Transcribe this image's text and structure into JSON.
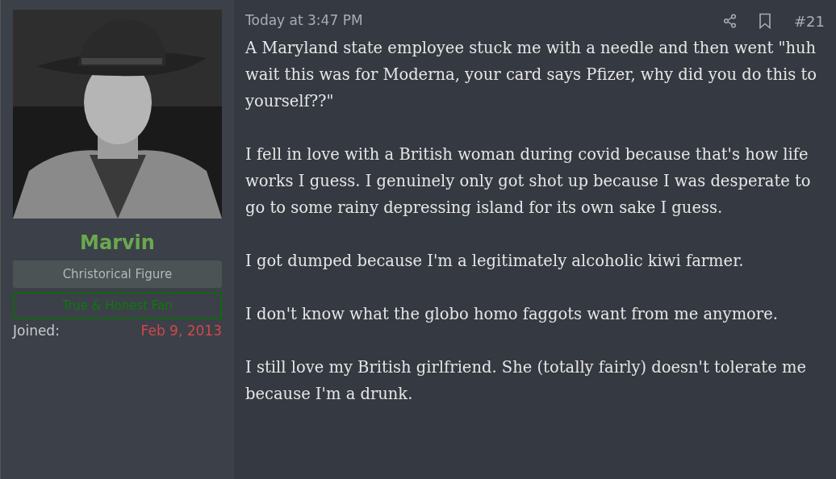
{
  "author": {
    "name": "Marvin",
    "title": "Christorical Figure",
    "banner": "True & Honest Fan",
    "joined_label": "Joined:",
    "joined_value": "Feb 9, 2013"
  },
  "post": {
    "time": "Today at 3:47 PM",
    "number": "#21",
    "paragraphs": [
      "A Maryland state employee stuck me with a needle and then went \"huh wait this was for Moderna, your card says Pfizer, why did you do this to yourself??\"",
      "I fell in love with a British woman during covid because that's how life works I guess. I genuinely only got shot up because I was desperate to go to some rainy depressing island for its own sake I guess.",
      "I got dumped because I'm a legitimately alcoholic kiwi farmer.",
      "I don't know what the globo homo faggots want from me anymore.",
      "I still love my British girlfriend. She (totally fairly) doesn't tolerate me because I'm a drunk."
    ]
  }
}
